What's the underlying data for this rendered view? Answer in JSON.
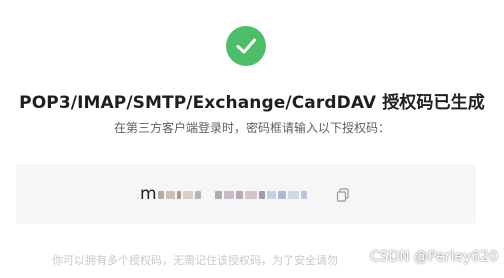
{
  "status": {
    "icon": "check-circle-icon",
    "color": "#4ebd6a"
  },
  "title": "POP3/IMAP/SMTP/Exchange/CardDAV 授权码已生成",
  "subtitle": "在第三方客户端登录时，密码框请输入以下授权码：",
  "auth_code": {
    "visible_prefix": "m",
    "obscured": true
  },
  "copy_button": {
    "icon": "copy-icon"
  },
  "footer_text": "你可以拥有多个授权码，无需记住该授权码，为了安全请勿",
  "watermark": "CSDN @Perley620"
}
